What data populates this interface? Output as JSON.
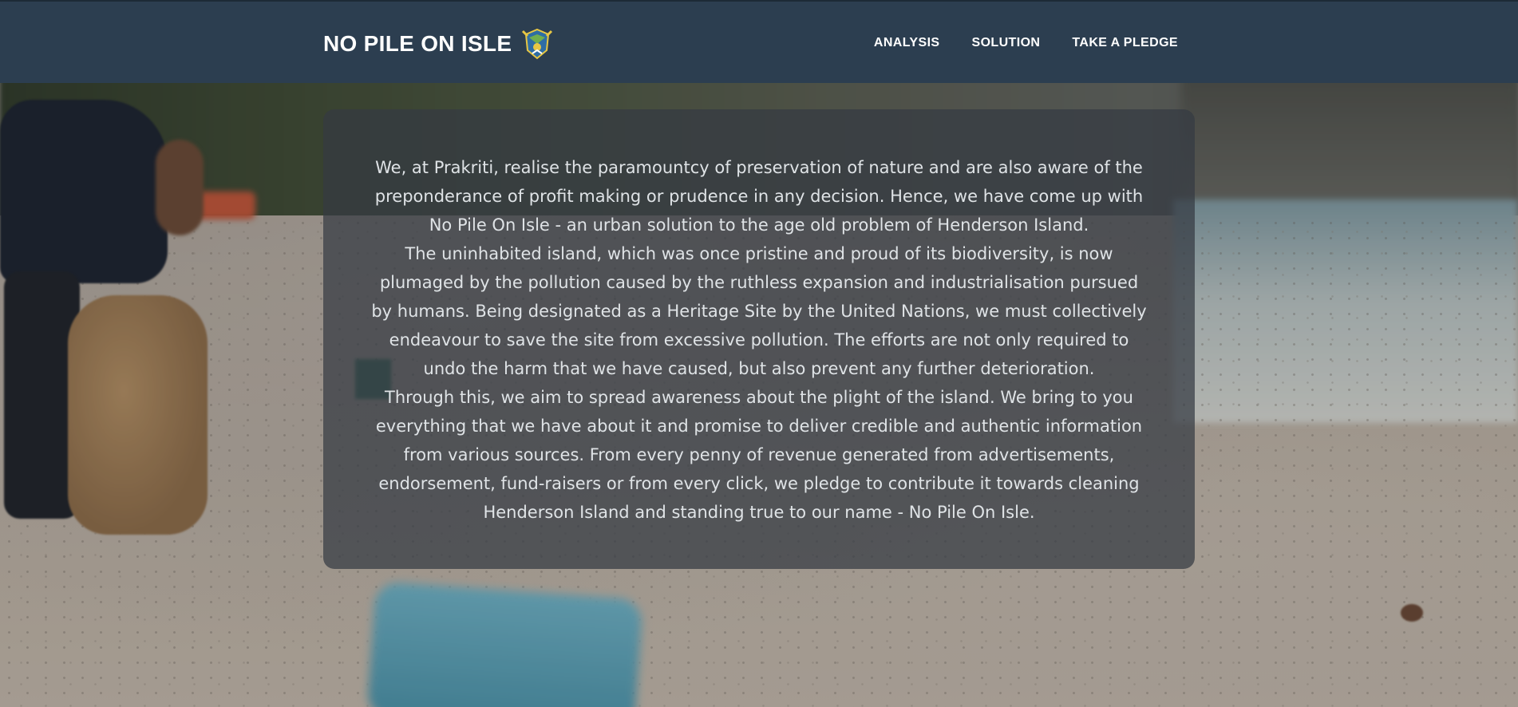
{
  "header": {
    "brand": "NO PILE ON ISLE",
    "brand_logo_icon": "coat-of-arms-icon",
    "nav": [
      {
        "label": "ANALYSIS"
      },
      {
        "label": "SOLUTION"
      },
      {
        "label": "TAKE A PLEDGE"
      }
    ]
  },
  "main": {
    "paragraphs": [
      "We, at Prakriti, realise the paramountcy of preservation of nature and are also aware of the preponderance of profit making or prudence in any decision. Hence, we have come up with No Pile On Isle - an urban solution to the age old problem of Henderson Island.",
      "The uninhabited island, which was once pristine and proud of its biodiversity, is now plumaged by the pollution caused by the ruthless expansion and industrialisation pursued by humans. Being designated as a Heritage Site by the United Nations, we must collectively endeavour to save the site from excessive pollution. The efforts are not only required to undo the harm that we have caused, but also prevent any further deterioration.",
      "Through this, we aim to spread awareness about the plight of the island. We bring to you everything that we have about it and promise to deliver credible and authentic information from various sources. From every penny of revenue generated from advertisements, endorsement, fund-raisers or from every click, we pledge to contribute it towards cleaning Henderson Island and standing true to our name - No Pile On Isle."
    ]
  },
  "colors": {
    "navbar": "#2c3e50",
    "panel": "rgba(52,58,66,0.72)",
    "text": "#dfe3e6"
  }
}
